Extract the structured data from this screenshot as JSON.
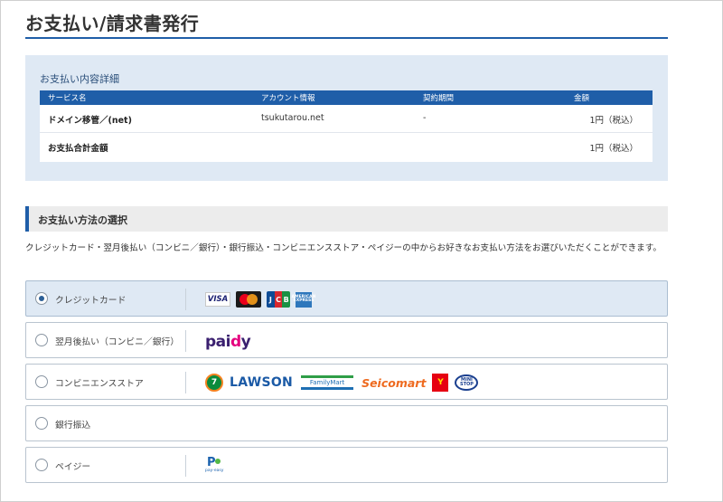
{
  "page": {
    "title": "お支払い/請求書発行"
  },
  "detail": {
    "heading": "お支払い内容詳細",
    "columns": [
      "サービス名",
      "アカウント情報",
      "契約期間",
      "金額"
    ],
    "rows": [
      {
        "service": "ドメイン移管／(net)",
        "account": "tsukutarou.net",
        "period": "-",
        "amount": "1円（税込）"
      }
    ],
    "total": {
      "label": "お支払合計金額",
      "amount": "1円（税込）"
    }
  },
  "method": {
    "heading": "お支払い方法の選択",
    "description": "クレジットカード・翌月後払い（コンビニ／銀行）・銀行振込・コンビニエンスストア・ペイジーの中からお好きなお支払い方法をお選びいただくことができます。",
    "options": [
      {
        "label": "クレジットカード",
        "selected": true,
        "logos": [
          "visa-logo",
          "mastercard-logo",
          "jcb-logo",
          "amex-logo"
        ]
      },
      {
        "label": "翌月後払い（コンビニ／銀行）",
        "selected": false,
        "logos": [
          "paidy-logo"
        ]
      },
      {
        "label": "コンビニエンスストア",
        "selected": false,
        "logos": [
          "seven-eleven-logo",
          "lawson-logo",
          "familymart-logo",
          "seicomart-logo",
          "daily-yamazaki-logo",
          "ministop-logo"
        ]
      },
      {
        "label": "銀行振込",
        "selected": false,
        "logos": []
      },
      {
        "label": "ペイジー",
        "selected": false,
        "logos": [
          "payeasy-logo"
        ]
      }
    ]
  },
  "logo_text": {
    "visa": "VISA",
    "jcb": [
      "J",
      "C",
      "B"
    ],
    "amex": "AMERICAN EXPRESS",
    "paidy": [
      "pai",
      "d",
      "y"
    ],
    "seven_eleven": "7",
    "lawson": "LAWSON",
    "familymart": "FamilyMart",
    "seicomart": "Seicomart",
    "daily": "Y",
    "ministop": "MINI STOP",
    "payeasy": [
      "P",
      "pay-easy"
    ]
  },
  "colors": {
    "accent": "#1f5ea8",
    "panel": "#dfe9f4",
    "selected_bg": "#dfe9f4",
    "heading_bg": "#ececec"
  }
}
